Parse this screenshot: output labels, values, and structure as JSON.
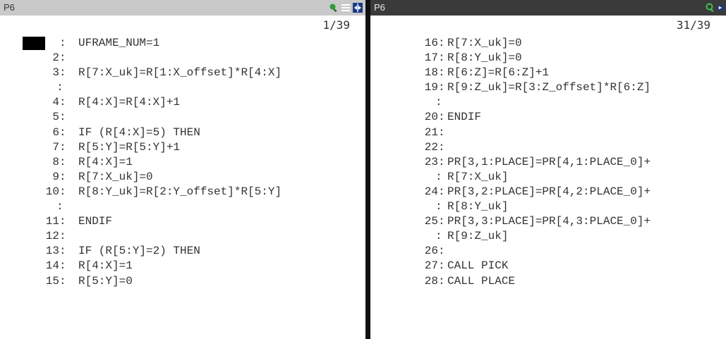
{
  "left_pane": {
    "title": "P6",
    "page": "1/39",
    "icons": [
      "zoom-icon",
      "list-icon",
      "maximize-icon"
    ],
    "lines": [
      {
        "num": "1",
        "text": "UFRAME_NUM=1",
        "current": true
      },
      {
        "num": "2",
        "text": ""
      },
      {
        "num": "3",
        "text": "R[7:X_uk]=R[1:X_offset]*R[4:X]"
      },
      {
        "num": "",
        "text": ""
      },
      {
        "num": "4",
        "text": "R[4:X]=R[4:X]+1"
      },
      {
        "num": "5",
        "text": ""
      },
      {
        "num": "6",
        "text": "IF (R[4:X]=5) THEN"
      },
      {
        "num": "7",
        "text": "R[5:Y]=R[5:Y]+1"
      },
      {
        "num": "8",
        "text": "R[4:X]=1"
      },
      {
        "num": "9",
        "text": "R[7:X_uk]=0"
      },
      {
        "num": "10",
        "text": "R[8:Y_uk]=R[2:Y_offset]*R[5:Y]"
      },
      {
        "num": "",
        "text": ""
      },
      {
        "num": "11",
        "text": "ENDIF"
      },
      {
        "num": "12",
        "text": ""
      },
      {
        "num": "13",
        "text": "IF (R[5:Y]=2) THEN"
      },
      {
        "num": "14",
        "text": "R[4:X]=1"
      },
      {
        "num": "15",
        "text": "R[5:Y]=0"
      }
    ]
  },
  "right_pane": {
    "title": "P6",
    "page": "31/39",
    "icons": [
      "zoom-icon",
      "split-icon"
    ],
    "lines": [
      {
        "num": "16",
        "text": "R[7:X_uk]=0"
      },
      {
        "num": "17",
        "text": "R[8:Y_uk]=0"
      },
      {
        "num": "18",
        "text": "R[6:Z]=R[6:Z]+1"
      },
      {
        "num": "19",
        "text": "R[9:Z_uk]=R[3:Z_offset]*R[6:Z]"
      },
      {
        "num": "",
        "text": ""
      },
      {
        "num": "20",
        "text": "ENDIF"
      },
      {
        "num": "21",
        "text": ""
      },
      {
        "num": "22",
        "text": ""
      },
      {
        "num": "23",
        "text": "PR[3,1:PLACE]=PR[4,1:PLACE_0]+"
      },
      {
        "num": "",
        "text": "R[7:X_uk]"
      },
      {
        "num": "24",
        "text": "PR[3,2:PLACE]=PR[4,2:PLACE_0]+"
      },
      {
        "num": "",
        "text": "R[8:Y_uk]"
      },
      {
        "num": "25",
        "text": "PR[3,3:PLACE]=PR[4,3:PLACE_0]+"
      },
      {
        "num": "",
        "text": "R[9:Z_uk]"
      },
      {
        "num": "26",
        "text": ""
      },
      {
        "num": "27",
        "text": "CALL PICK"
      },
      {
        "num": "28",
        "text": "CALL PLACE"
      }
    ]
  },
  "colors": {
    "left_titlebar": "#c9c9c9",
    "right_titlebar": "#3a3a3a",
    "icon_green": "#2e9b3a",
    "text": "#333333",
    "cursor": "#000000"
  }
}
